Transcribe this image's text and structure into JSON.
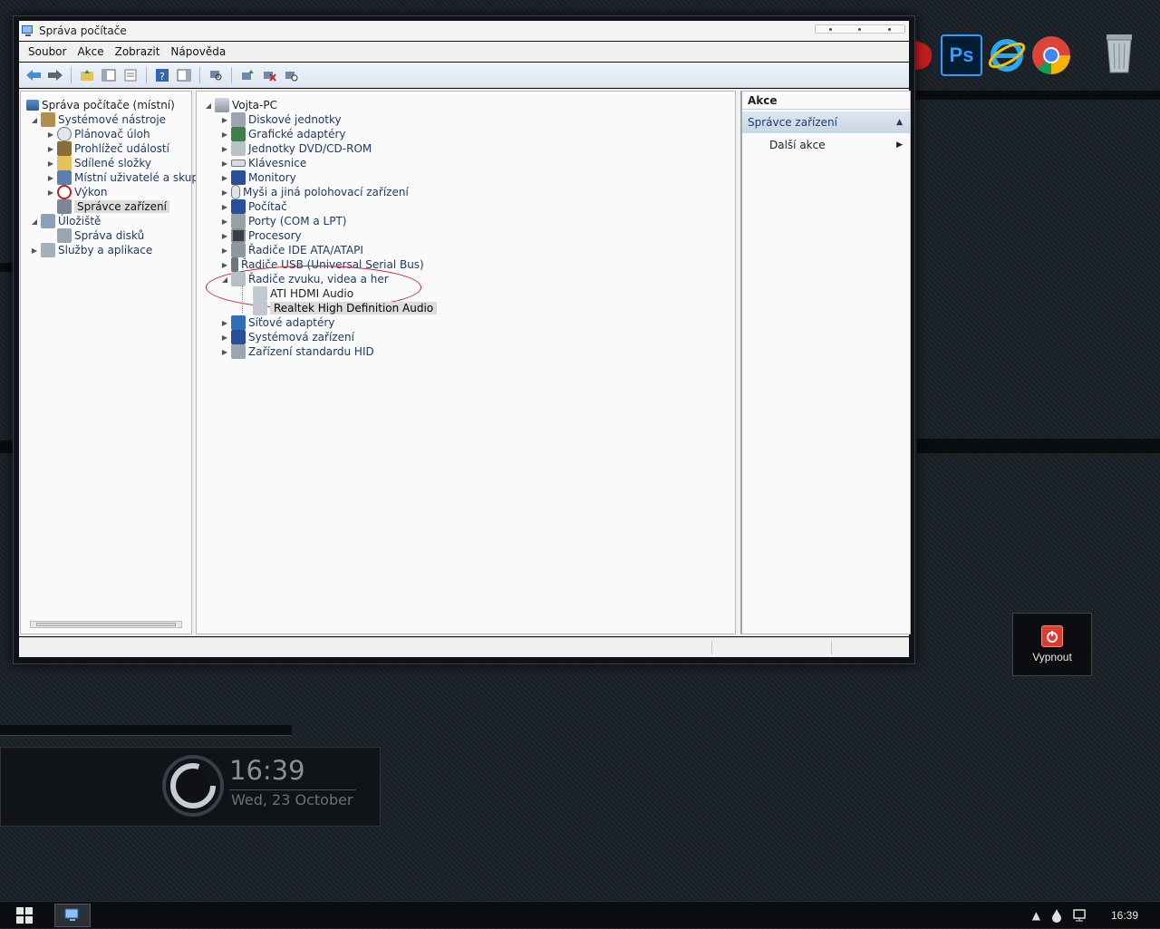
{
  "window": {
    "title": "Správa počítače",
    "menu": [
      "Soubor",
      "Akce",
      "Zobrazit",
      "Nápověda"
    ]
  },
  "left_tree": {
    "root": "Správa počítače (místní)",
    "items": [
      {
        "label": "Systémové nástroje",
        "icon": "tools-icon"
      },
      {
        "label": "Plánovač úloh",
        "icon": "clock-icon"
      },
      {
        "label": "Prohlížeč událostí",
        "icon": "event-viewer-icon"
      },
      {
        "label": "Sdílené složky",
        "icon": "shared-folder-icon"
      },
      {
        "label": "Místní uživatelé a skupiny",
        "icon": "users-icon"
      },
      {
        "label": "Výkon",
        "icon": "performance-icon"
      },
      {
        "label": "Správce zařízení",
        "icon": "device-manager-icon"
      },
      {
        "label": "Úložiště",
        "icon": "storage-icon"
      },
      {
        "label": "Správa disků",
        "icon": "disk-icon"
      },
      {
        "label": "Služby a aplikace",
        "icon": "services-icon"
      }
    ]
  },
  "device_tree": {
    "computer": "Vojta-PC",
    "categories": [
      "Diskové jednotky",
      "Grafické adaptéry",
      "Jednotky DVD/CD-ROM",
      "Klávesnice",
      "Monitory",
      "Myši a jiná polohovací zařízení",
      "Počítač",
      "Porty (COM a LPT)",
      "Procesory",
      "Řadiče IDE ATA/ATAPI",
      "Řadiče USB (Universal Serial Bus)",
      "Řadiče zvuku, videa a her",
      "Síťové adaptéry",
      "Systémová zařízení",
      "Zařízení standardu HID"
    ],
    "expanded_children": [
      "ATI HDMI Audio",
      "Realtek High Definition Audio"
    ]
  },
  "actions": {
    "header": "Akce",
    "section": "Správce zařízení",
    "more": "Další akce"
  },
  "desktop": {
    "ps_label": "Ps",
    "shutdown_label": "Vypnout",
    "clock_time": "16:39",
    "clock_date": "Wed, 23 October"
  },
  "taskbar": {
    "time": "16:39"
  }
}
